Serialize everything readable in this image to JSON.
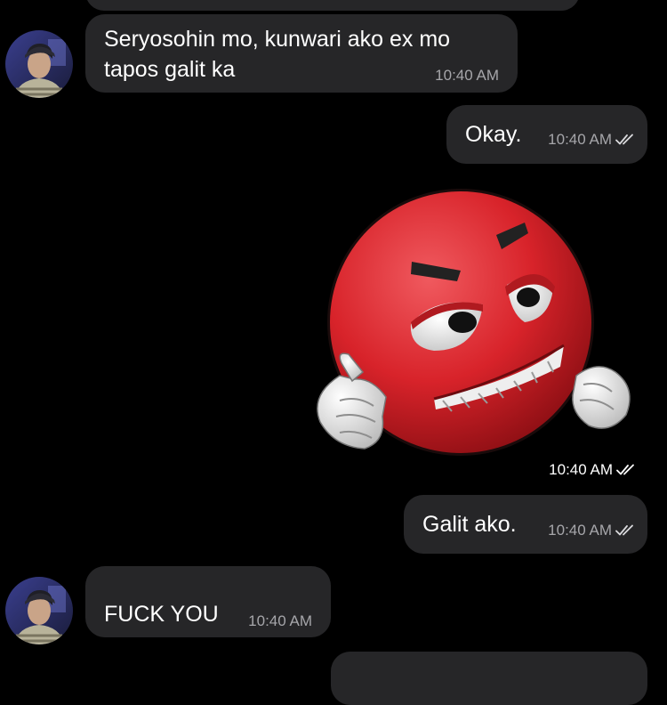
{
  "messages": [
    {
      "text": "Seryosohin mo, kunwari ako ex mo\ntapos galit ka",
      "time": "10:40 AM"
    },
    {
      "text": "Okay.",
      "time": "10:40 AM"
    },
    {
      "sticker": "angry-red-emoji-fists-icon",
      "time": "10:40 AM"
    },
    {
      "text": "Galit ako.",
      "time": "10:40 AM"
    },
    {
      "text": "FUCK YOU",
      "time": "10:40 AM"
    }
  ],
  "colors": {
    "background": "#000000",
    "bubble": "#262628",
    "timestamp": "#a6a6aa",
    "sticker_red": "#d8232a"
  },
  "icons": {
    "read_receipt": "double-check-icon",
    "avatar": "contact-avatar"
  }
}
